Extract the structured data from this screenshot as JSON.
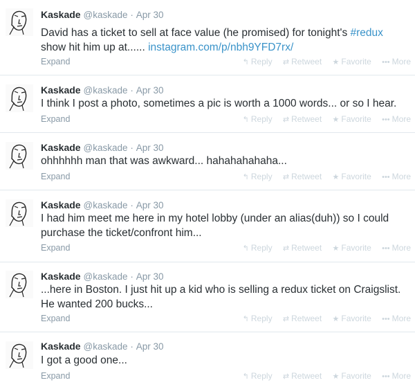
{
  "tweets": [
    {
      "name": "Kaskade",
      "handle": "@kaskade",
      "sep": "·",
      "date": "Apr 30",
      "text_pre": "David has a ticket to sell at face value (he promised) for tonight's ",
      "hashtag": "#redux",
      "text_mid": " show hit him up at...... ",
      "link": "instagram.com/p/nbh9YFD7rx/",
      "expand": "Expand"
    },
    {
      "name": "Kaskade",
      "handle": "@kaskade",
      "sep": "·",
      "date": "Apr 30",
      "text": "I think I post a photo, sometimes a pic is worth a 1000 words... or so I hear.",
      "expand": "Expand"
    },
    {
      "name": "Kaskade",
      "handle": "@kaskade",
      "sep": "·",
      "date": "Apr 30",
      "text": "ohhhhhh man that was awkward...  hahahahahaha...",
      "expand": "Expand"
    },
    {
      "name": "Kaskade",
      "handle": "@kaskade",
      "sep": "·",
      "date": "Apr 30",
      "text": "I had him meet me here in my hotel lobby (under an alias(duh)) so I could purchase the ticket/confront him...",
      "expand": "Expand"
    },
    {
      "name": "Kaskade",
      "handle": "@kaskade",
      "sep": "·",
      "date": "Apr 30",
      "text": "...here in Boston. I just hit up a kid who is selling a redux ticket on Craigslist. He wanted 200 bucks...",
      "expand": "Expand"
    },
    {
      "name": "Kaskade",
      "handle": "@kaskade",
      "sep": "·",
      "date": "Apr 30",
      "text": "I got a good one...",
      "expand": "Expand"
    }
  ],
  "actions": {
    "reply": "Reply",
    "retweet": "Retweet",
    "favorite": "Favorite",
    "more": "More"
  },
  "icons": [
    "reply-icon",
    "retweet-icon",
    "favorite-icon",
    "more-icon",
    "avatar-sketch"
  ]
}
